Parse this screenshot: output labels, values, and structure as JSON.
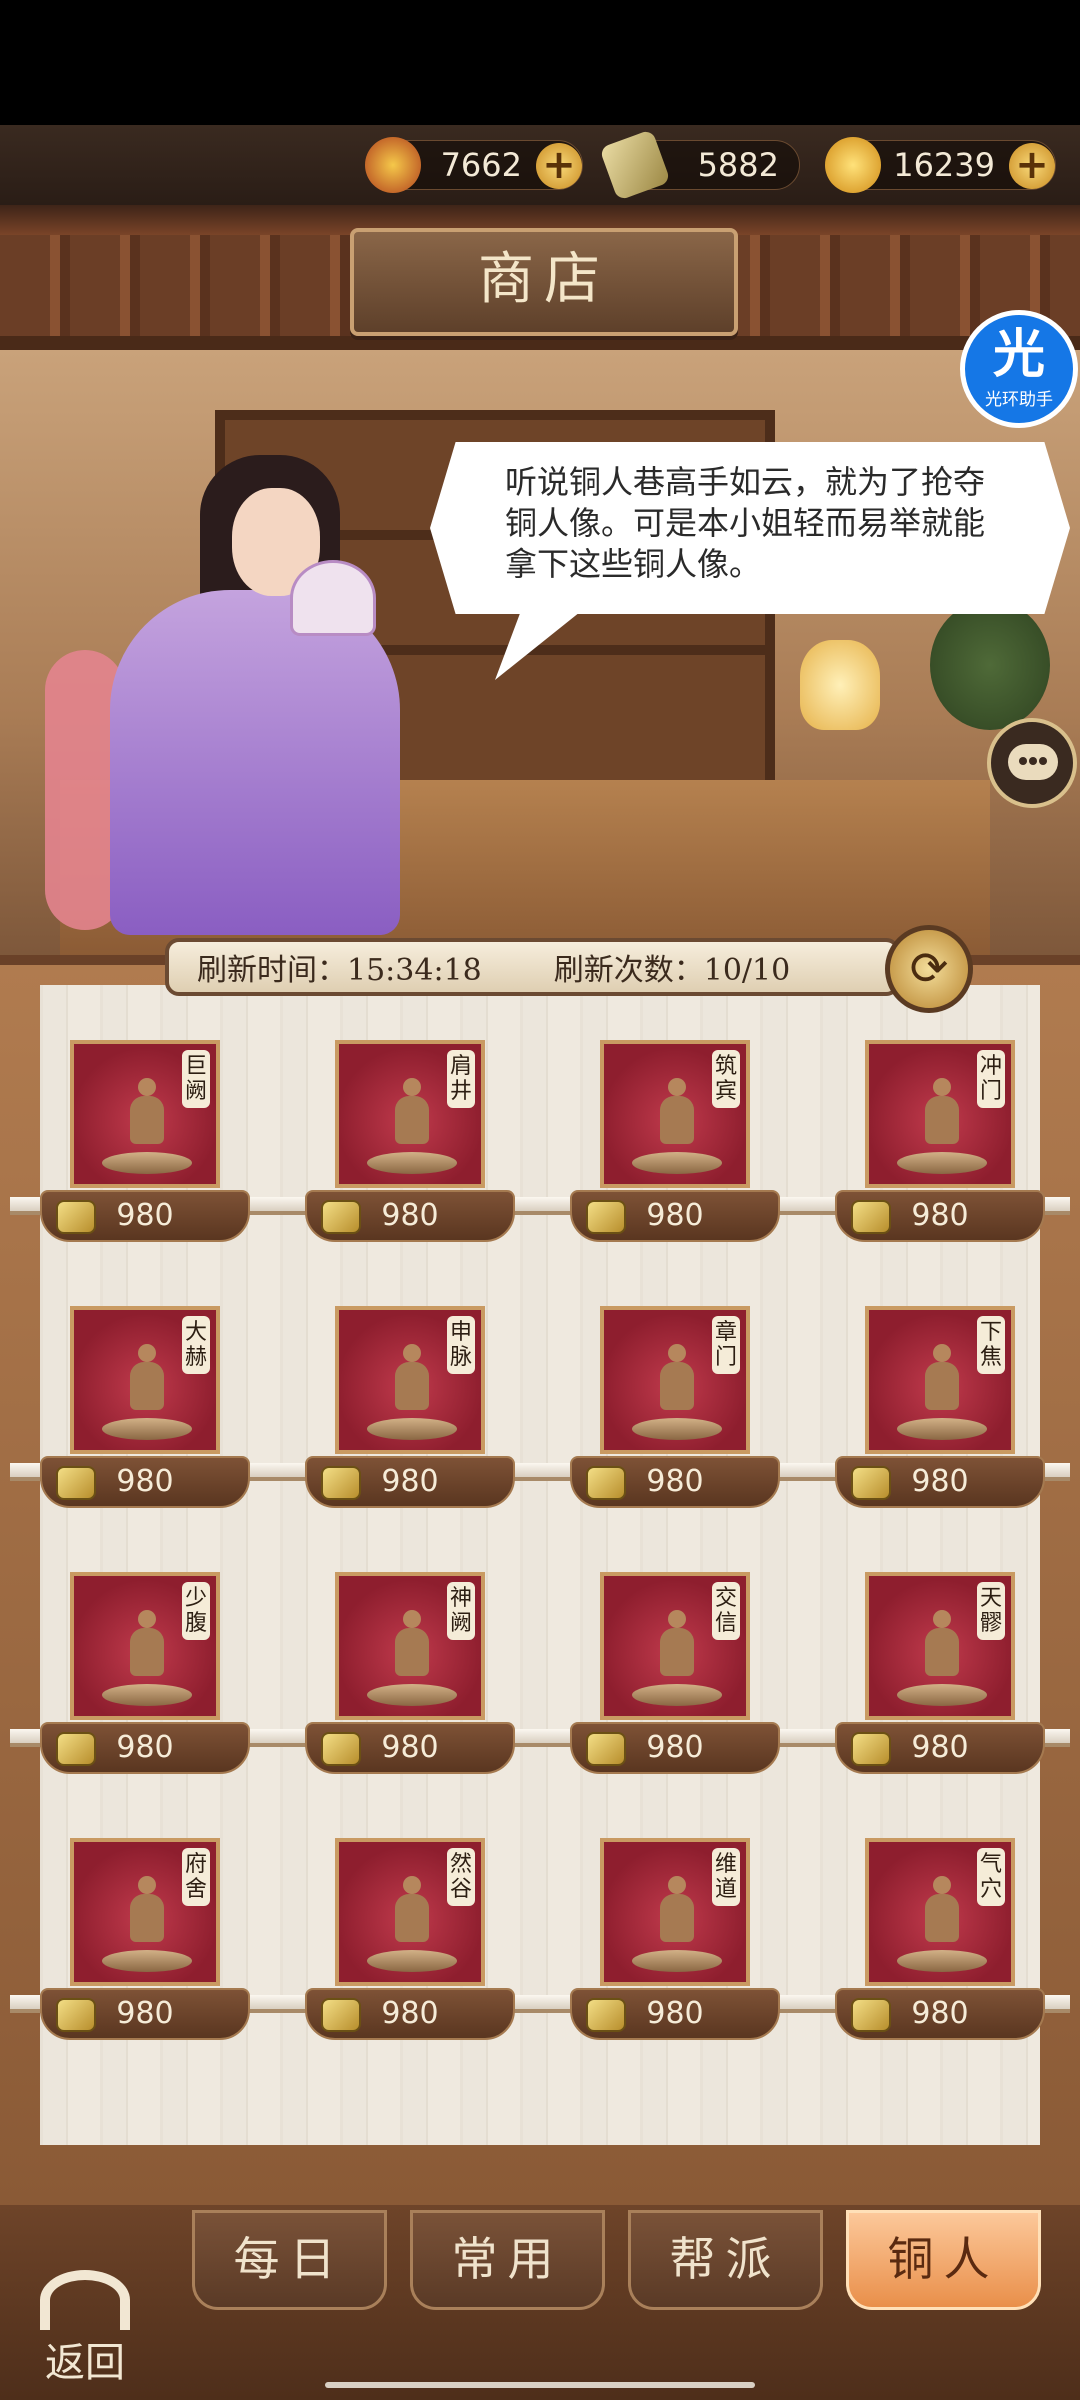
{
  "currencies": [
    {
      "icon": "dragon-emblem-icon",
      "value": "7662",
      "has_plus": true
    },
    {
      "icon": "silver-ingot-icon",
      "value": "5882",
      "has_plus": false
    },
    {
      "icon": "gold-ingot-icon",
      "value": "16239",
      "has_plus": true
    }
  ],
  "shop_title": "商店",
  "dialogue": "听说铜人巷高手如云，就为了抢夺铜人像。可是本小姐轻而易举就能拿下这些铜人像。",
  "helper": {
    "icon_text": "光",
    "label": "光环助手"
  },
  "refresh": {
    "time_label": "刷新时间：15:34:18",
    "count_label": "刷新次数：10/10"
  },
  "items": [
    {
      "name": "巨阙",
      "price": "980"
    },
    {
      "name": "肩井",
      "price": "980"
    },
    {
      "name": "筑宾",
      "price": "980"
    },
    {
      "name": "冲门",
      "price": "980"
    },
    {
      "name": "大赫",
      "price": "980"
    },
    {
      "name": "申脉",
      "price": "980"
    },
    {
      "name": "章门",
      "price": "980"
    },
    {
      "name": "下焦",
      "price": "980"
    },
    {
      "name": "少腹",
      "price": "980"
    },
    {
      "name": "神阙",
      "price": "980"
    },
    {
      "name": "交信",
      "price": "980"
    },
    {
      "name": "天髎",
      "price": "980"
    },
    {
      "name": "府舍",
      "price": "980"
    },
    {
      "name": "然谷",
      "price": "980"
    },
    {
      "name": "维道",
      "price": "980"
    },
    {
      "name": "气穴",
      "price": "980"
    }
  ],
  "tabs": [
    {
      "label": "每日",
      "active": false
    },
    {
      "label": "常用",
      "active": false
    },
    {
      "label": "帮派",
      "active": false
    },
    {
      "label": "铜人",
      "active": true
    }
  ],
  "back_label": "返回",
  "colors": {
    "accent_tab": "#e98f4a",
    "card_red": "#8e1e2e",
    "helper_blue": "#1577e6"
  }
}
